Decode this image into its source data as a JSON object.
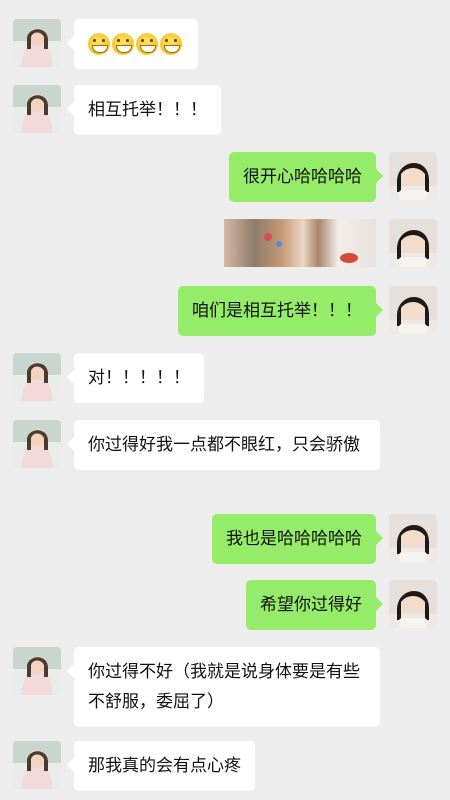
{
  "colors": {
    "background": "#ededed",
    "friend_bubble": "#ffffff",
    "my_bubble": "#95ec69"
  },
  "messages": [
    {
      "sender": "friend",
      "type": "emoji",
      "emoji": "grinning-face",
      "count": 4
    },
    {
      "sender": "friend",
      "type": "text",
      "text": "相互托举！！！"
    },
    {
      "sender": "me",
      "type": "text",
      "text": "很开心哈哈哈哈"
    },
    {
      "sender": "me",
      "type": "image",
      "image": "photo-thumbnail"
    },
    {
      "sender": "me",
      "type": "text",
      "text": "咱们是相互托举！！！"
    },
    {
      "sender": "friend",
      "type": "text",
      "text": "对！！！！！"
    },
    {
      "sender": "friend",
      "type": "text",
      "text": "你过得好我一点都不眼红，只会骄傲"
    },
    {
      "sender": "me",
      "type": "text",
      "text": "我也是哈哈哈哈哈"
    },
    {
      "sender": "me",
      "type": "text",
      "text": "希望你过得好"
    },
    {
      "sender": "friend",
      "type": "text",
      "text": "你过得不好（我就是说身体要是有些不舒服，委屈了）"
    },
    {
      "sender": "friend",
      "type": "text",
      "text": "那我真的会有点心疼"
    }
  ]
}
